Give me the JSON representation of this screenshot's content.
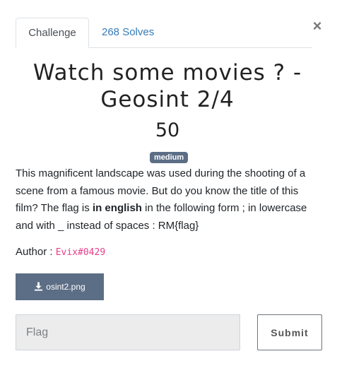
{
  "tabs": {
    "challenge_label": "Challenge",
    "solves_label": "268 Solves"
  },
  "close_label": "×",
  "challenge": {
    "title": "Watch some movies ? - Geosint 2/4",
    "value": "50",
    "difficulty": "medium",
    "description": {
      "part1": "This magnificent landscape was used during the shooting of a scene from a famous movie. But do you know the title of this film? The flag is ",
      "bold": "in english",
      "part2": " in the following form ; in lowercase and with _ instead of spaces : RM{flag}"
    },
    "author_label": "Author : ",
    "author_name": "Evix#0429",
    "file_name": "osint2.png"
  },
  "flag_input": {
    "placeholder": "Flag",
    "value": ""
  },
  "submit_label": "Submit",
  "colors": {
    "accent": "#5c6e85",
    "link": "#337ab7",
    "author": "#e83e8c"
  }
}
